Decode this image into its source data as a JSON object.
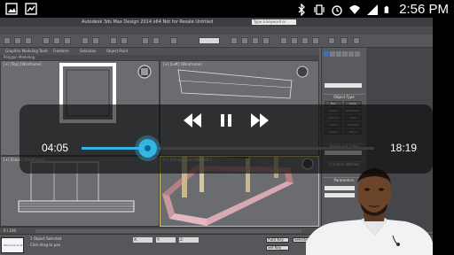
{
  "status_bar": {
    "time": "2:56 PM",
    "left_icons": [
      "image-icon",
      "stats-icon"
    ],
    "right_icons": [
      "bluetooth-icon",
      "vibrate-icon",
      "alarm-icon",
      "wifi-icon",
      "signal-icon",
      "battery-icon"
    ]
  },
  "video": {
    "app_title": "Autodesk 3ds Max Design 2014 x64   Not for Resale   Untitled",
    "search_placeholder": "Type a keyword or phrase",
    "ribbon_tabs": [
      "Graphite Modeling Tools",
      "Freeform",
      "Selection",
      "Object Paint"
    ],
    "ribbon_sub": "Polygon Modeling",
    "viewports": [
      "[+] [Top] [Wireframe]",
      "[+] [Front] [Wireframe]",
      "[+] [Left] [Wireframe]",
      "[+] [Perspective] [Realistic]"
    ],
    "command_panel": {
      "header": "Object Type",
      "buttons": [
        "AutoGrid",
        "Box",
        "Cone",
        "Sphere",
        "GeoSphere",
        "Cylinder",
        "Tube",
        "Torus",
        "Pyramid",
        "Teapot",
        "Plane"
      ],
      "name_color": "Name and Color",
      "creation": "Creation Method",
      "params": "Parameters"
    },
    "timeline": {
      "frame": "0 / 100"
    },
    "bottom": {
      "script_label": "Welcome to M",
      "status1": "1 Object Selected",
      "status2": "Click-drag to pan",
      "coords": [
        "X:",
        "Y:",
        "Z:"
      ],
      "auto_key": "Auto Key",
      "set_key": "Set Key",
      "selected": "Selected"
    }
  },
  "player": {
    "current_time": "04:05",
    "total_time": "18:19",
    "progress": 0.223,
    "accent": "#33b5e5"
  }
}
